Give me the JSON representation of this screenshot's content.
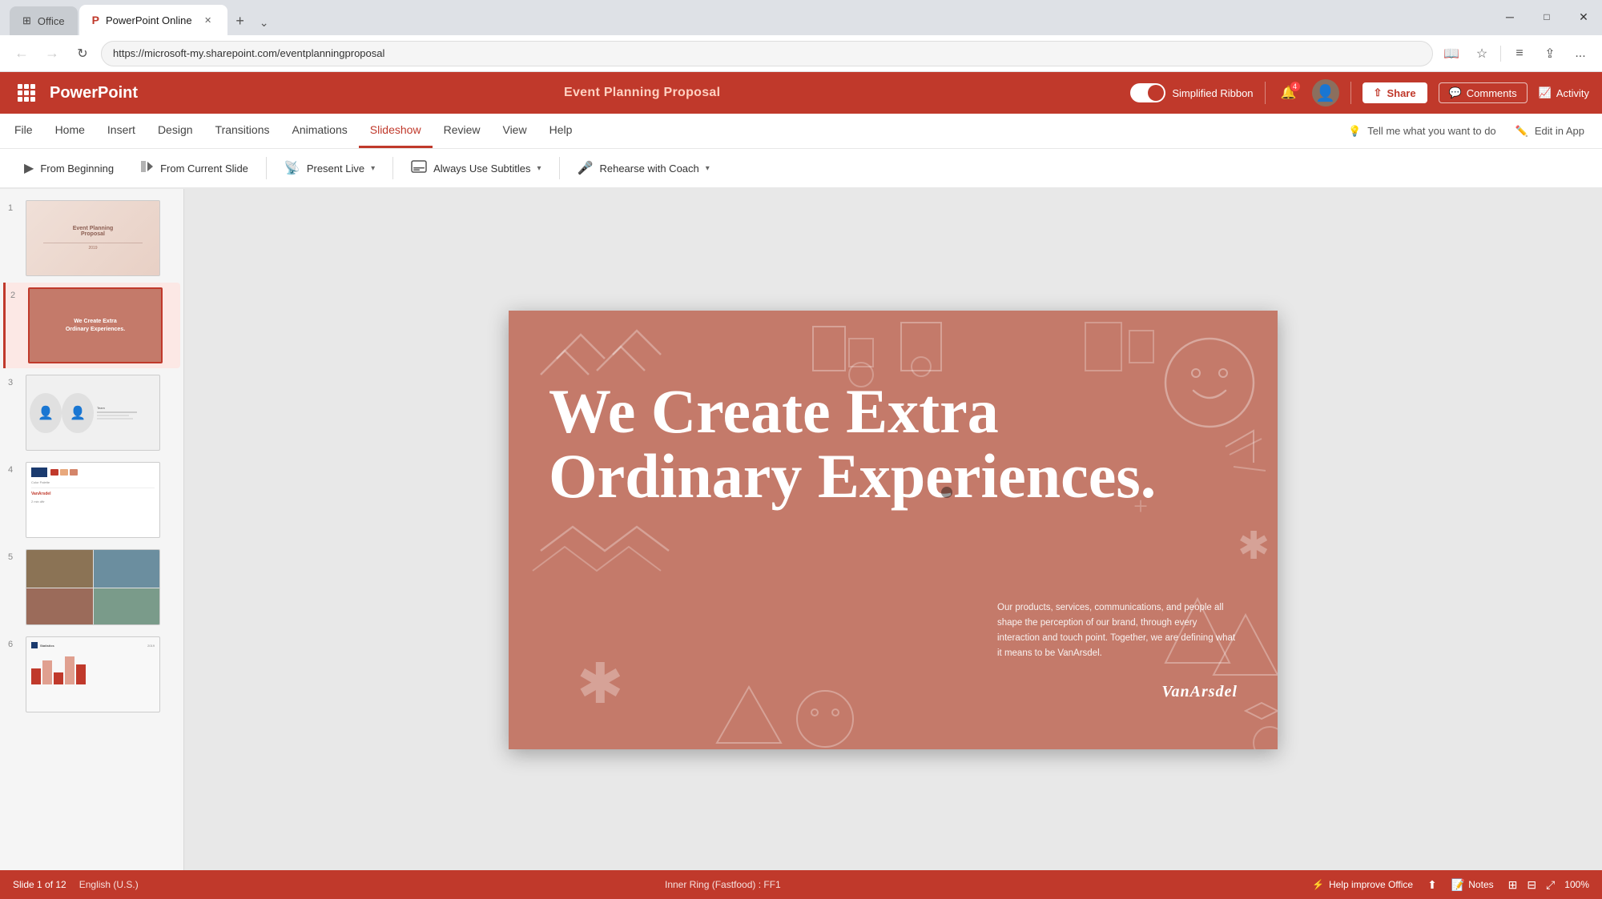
{
  "browser": {
    "tabs": [
      {
        "id": "home",
        "label": "Office",
        "icon": "🏠",
        "active": false
      },
      {
        "id": "ppt",
        "label": "PowerPoint Online",
        "icon": "📊",
        "active": true
      }
    ],
    "address": "https://microsoft-my.sharepoint.com/eventplanningproposal",
    "win_controls": [
      "─",
      "□",
      "✕"
    ]
  },
  "app": {
    "title": "Event Planning Proposal",
    "name": "PowerPoint",
    "simplified_ribbon_label": "Simplified Ribbon",
    "notification_count": "4"
  },
  "ribbon": {
    "menu_items": [
      {
        "id": "file",
        "label": "File",
        "active": false
      },
      {
        "id": "home",
        "label": "Home",
        "active": false
      },
      {
        "id": "insert",
        "label": "Insert",
        "active": false
      },
      {
        "id": "design",
        "label": "Design",
        "active": false
      },
      {
        "id": "transitions",
        "label": "Transitions",
        "active": false
      },
      {
        "id": "animations",
        "label": "Animations",
        "active": false
      },
      {
        "id": "slideshow",
        "label": "Slideshow",
        "active": true
      },
      {
        "id": "review",
        "label": "Review",
        "active": false
      },
      {
        "id": "view",
        "label": "View",
        "active": false
      },
      {
        "id": "help",
        "label": "Help",
        "active": false
      }
    ],
    "tell_me_label": "Tell me what you want to do",
    "edit_in_app_label": "Edit in App"
  },
  "toolbar": {
    "from_beginning_label": "From Beginning",
    "from_current_label": "From Current Slide",
    "present_live_label": "Present Live",
    "subtitles_label": "Always Use Subtitles",
    "rehearse_label": "Rehearse with Coach"
  },
  "header_actions": {
    "share_label": "Share",
    "comments_label": "Comments",
    "activity_label": "Activity"
  },
  "slides": [
    {
      "num": "1",
      "thumb_type": "1",
      "title": "Event Planning Proposal",
      "subtitle": "2019"
    },
    {
      "num": "2",
      "thumb_type": "2",
      "text": "We Create Extra Ordinary Experiences."
    },
    {
      "num": "3",
      "thumb_type": "3"
    },
    {
      "num": "4",
      "thumb_type": "4"
    },
    {
      "num": "5",
      "thumb_type": "5"
    },
    {
      "num": "6",
      "thumb_type": "6"
    }
  ],
  "slide_canvas": {
    "main_text_line1": "We Create Extra",
    "main_text_line2": "Ordinary Experiences.",
    "description": "Our products, services, communications, and people all shape the perception of our brand, through every interaction and touch point. Together, we are defining what it means to be VanArsdel.",
    "brand": "VanArsdel"
  },
  "status_bar": {
    "slide_info": "Slide 1 of 12",
    "language": "English (U.S.)",
    "ring_info": "Inner Ring (Fastfood) : FF1",
    "help_label": "Help improve Office",
    "notes_label": "Notes",
    "zoom": "100%"
  }
}
